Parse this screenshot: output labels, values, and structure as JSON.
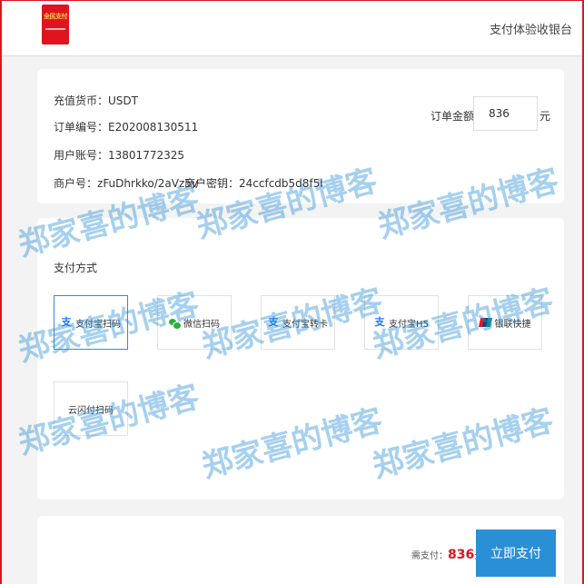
{
  "header": {
    "logo_text": "全民支付",
    "title": "支付体验收银台"
  },
  "order": {
    "currency_label": "充值货币：",
    "currency_value": "USDT",
    "order_no_label": "订单编号：",
    "order_no_value": "E2020081305110246637",
    "account_label": "用户账号：",
    "account_value": "13801772325",
    "merchant_no_label": "商户号：",
    "merchant_no_value": "zFuDhrkko/2aVz5v",
    "merchant_key_label": "商户密钥：",
    "merchant_key_value": "24ccfcdb5d8f5b7a86e9d63",
    "amount_label": "订单金额：",
    "amount_value": "836",
    "amount_unit": "元"
  },
  "payment": {
    "title": "支付方式",
    "methods": [
      {
        "label": "支付宝扫码",
        "icon": "alipay-icon",
        "selected": true
      },
      {
        "label": "微信扫码",
        "icon": "wechat-icon",
        "selected": false
      },
      {
        "label": "支付宝转卡",
        "icon": "alipay-icon",
        "selected": false
      },
      {
        "label": "支付宝H5",
        "icon": "alipay-icon",
        "selected": false
      },
      {
        "label": "银联快捷",
        "icon": "unionpay-icon",
        "selected": false
      },
      {
        "label": "云闪付扫码",
        "icon": "",
        "selected": false
      }
    ]
  },
  "footer": {
    "need_pay_label": "需支付：",
    "need_pay_amount": "836",
    "need_pay_unit": "元",
    "pay_button": "立即支付"
  },
  "watermark": {
    "text": "郑家喜的博客"
  },
  "colors": {
    "accent": "#2b8fd6",
    "brand_red": "#e0141e",
    "wechat_green": "#2aae3b"
  }
}
